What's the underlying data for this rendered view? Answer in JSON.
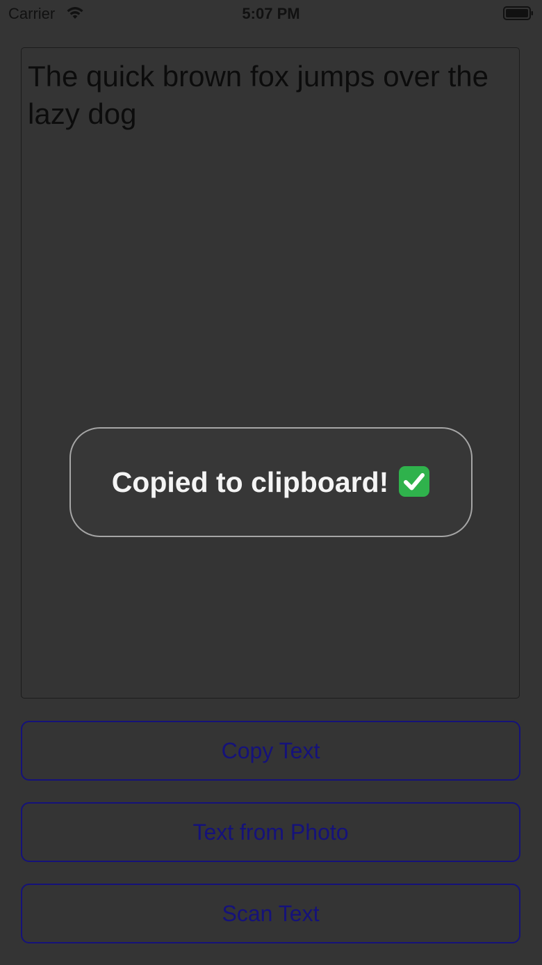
{
  "status_bar": {
    "carrier": "Carrier",
    "time": "5:07 PM"
  },
  "text_view": {
    "value": "The quick brown fox jumps over the lazy dog"
  },
  "toast": {
    "message": "Copied to clipboard!",
    "icon": "check-mark-button-icon"
  },
  "buttons": {
    "copy_label": "Copy Text",
    "photo_label": "Text from Photo",
    "scan_label": "Scan Text"
  },
  "colors": {
    "background": "#343434",
    "button_accent": "#15127a",
    "toast_text": "#f4f4f4",
    "check_green": "#2fb24c"
  }
}
